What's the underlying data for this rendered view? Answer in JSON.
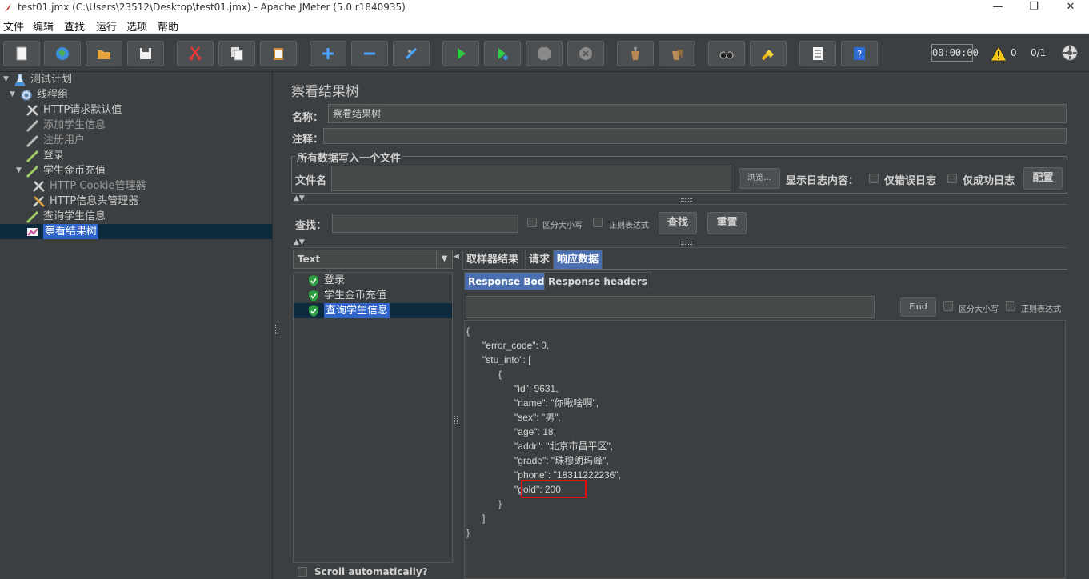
{
  "window": {
    "title": "test01.jmx (C:\\Users\\23512\\Desktop\\test01.jmx) - Apache JMeter (5.0 r1840935)",
    "minimize": "—",
    "maximize": "❐",
    "close": "✕"
  },
  "menu": [
    "文件",
    "编辑",
    "查找",
    "运行",
    "选项",
    "帮助"
  ],
  "toolbar": {
    "icons": [
      "new-icon",
      "templates-icon",
      "open-icon",
      "save-icon",
      "cut-icon",
      "copy-icon",
      "paste-icon",
      "expand-icon",
      "collapse-icon",
      "toggle-icon",
      "start-icon",
      "start-no-pause-icon",
      "stop-icon",
      "shutdown-icon",
      "clear-icon",
      "clear-all-icon",
      "search-icon",
      "reset-search-icon",
      "function-helper-icon",
      "help-icon"
    ],
    "timer": "00:00:00",
    "warnings": "0",
    "threads": "0/1"
  },
  "tree": [
    {
      "label": "测试计划",
      "icon": "test-plan-icon",
      "indent": 0,
      "toggle": "▼"
    },
    {
      "label": "线程组",
      "icon": "thread-group-icon",
      "indent": 1,
      "toggle": "▼"
    },
    {
      "label": "HTTP请求默认值",
      "icon": "config-icon",
      "indent": 2,
      "toggle": ""
    },
    {
      "label": "添加学生信息",
      "icon": "sampler-icon",
      "indent": 2,
      "toggle": ""
    },
    {
      "label": "注册用户",
      "icon": "sampler-icon",
      "indent": 2,
      "toggle": ""
    },
    {
      "label": "登录",
      "icon": "sampler-icon",
      "indent": 2,
      "toggle": ""
    },
    {
      "label": "学生金币充值",
      "icon": "sampler-icon",
      "indent": 2,
      "toggle": "▼"
    },
    {
      "label": "HTTP Cookie管理器",
      "icon": "config-icon",
      "indent": 3,
      "toggle": ""
    },
    {
      "label": "HTTP信息头管理器",
      "icon": "config-icon",
      "indent": 3,
      "toggle": ""
    },
    {
      "label": "查询学生信息",
      "icon": "sampler-icon",
      "indent": 2,
      "toggle": ""
    },
    {
      "label": "察看结果树",
      "icon": "listener-icon",
      "indent": 2,
      "toggle": "",
      "selected": true
    }
  ],
  "panel": {
    "title": "察看结果树",
    "name_label": "名称：",
    "name_value": "察看结果树",
    "comment_label": "注释：",
    "comment_value": "",
    "file_group_title": "所有数据写入一个文件",
    "filename_label": "文件名",
    "filename_value": "",
    "browse": "浏览...",
    "log_content_label": "显示日志内容：",
    "errors_only": "仅错误日志",
    "success_only": "仅成功日志",
    "configure": "配置",
    "search_label": "查找：",
    "search_value": "",
    "case_sensitive": "区分大小写",
    "regex": "正则表达式",
    "search_button": "查找",
    "reset_button": "重置"
  },
  "results": {
    "renderer": "Text",
    "items": [
      {
        "label": "登录",
        "selected": false
      },
      {
        "label": "学生金币充值",
        "selected": false
      },
      {
        "label": "查询学生信息",
        "selected": true
      }
    ],
    "scroll_auto": "Scroll automatically?"
  },
  "tabs": [
    "取样器结果",
    "请求",
    "响应数据"
  ],
  "active_tab": 2,
  "subtabs": [
    "Response Body",
    "Response headers"
  ],
  "active_subtab": 0,
  "find": {
    "value": "",
    "button": "Find",
    "case_sensitive": "区分大小写",
    "regex": "正则表达式"
  },
  "response_body": "{\n      \"error_code\": 0,\n      \"stu_info\": [\n            {\n                  \"id\": 9631,\n                  \"name\": \"你瞅啥啊\",\n                  \"sex\": \"男\",\n                  \"age\": 18,\n                  \"addr\": \"北京市昌平区\",\n                  \"grade\": \"珠穆朗玛峰\",\n                  \"phone\": \"18311222236\",\n                  \"gold\": 200\n            }\n      ]\n}",
  "colors": {
    "background": "#3c3f41",
    "selection": "#2f65ca",
    "active_tab": "#4b6eaf",
    "highlight_box": "#e01010"
  }
}
